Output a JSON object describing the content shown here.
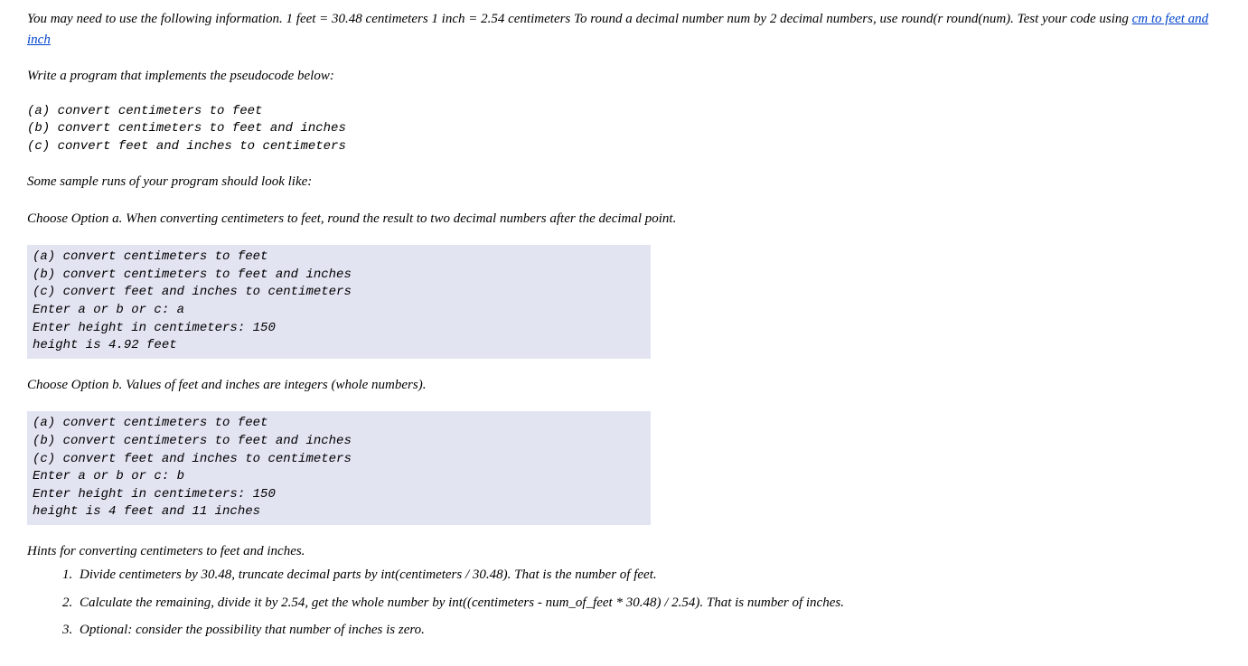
{
  "intro": {
    "text_before_link": "You may need to use the following information. 1 feet = 30.48 centimeters 1 inch = 2.54 centimeters To round a decimal number num by 2 decimal numbers, use round(r round(num). Test your code using ",
    "link_text": "cm to feet and inch"
  },
  "write_program": "Write a program that implements the pseudocode below:",
  "pseudocode": "(a) convert centimeters to feet\n(b) convert centimeters to feet and inches\n(c) convert feet and inches to centimeters",
  "sample_intro": "Some sample runs of your program should look like:",
  "option_a_heading": "Choose Option a. When converting centimeters to feet, round the result to two decimal numbers after the decimal point.",
  "sample_a": "(a) convert centimeters to feet\n(b) convert centimeters to feet and inches\n(c) convert feet and inches to centimeters\nEnter a or b or c: a\nEnter height in centimeters: 150\nheight is 4.92 feet",
  "option_b_heading": "Choose Option b. Values of feet and inches are integers (whole numbers).",
  "sample_b": "(a) convert centimeters to feet\n(b) convert centimeters to feet and inches\n(c) convert feet and inches to centimeters\nEnter a or b or c: b\nEnter height in centimeters: 150\nheight is 4 feet and 11 inches",
  "hints": {
    "heading": "Hints for converting centimeters to feet and inches.",
    "items": [
      "Divide centimeters by 30.48, truncate decimal parts by int(centimeters / 30.48). That is the number of feet.",
      "Calculate the remaining, divide it by 2.54, get the whole number by int((centimeters - num_of_feet * 30.48) / 2.54). That is number of inches.",
      "Optional: consider the possibility that number of inches is zero."
    ]
  }
}
